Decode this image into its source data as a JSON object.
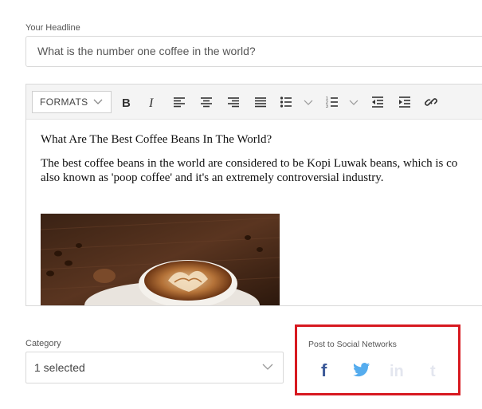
{
  "headline": {
    "label": "Your Headline",
    "value": "What is the number one coffee in the world?"
  },
  "editor": {
    "toolbar": {
      "formats_label": "FORMATS",
      "icons": [
        "bold-icon",
        "italic-icon",
        "align-left-icon",
        "align-center-icon",
        "align-right-icon",
        "align-justify-icon",
        "bullet-list-icon",
        "numbered-list-icon",
        "outdent-icon",
        "indent-icon",
        "link-icon"
      ]
    },
    "content": {
      "heading": "What Are The Best Coffee Beans In The World?",
      "paragraph_line1": "The best coffee beans in the world are considered to be Kopi Luwak beans, which is co",
      "paragraph_line2": "also known as 'poop coffee' and it's an extremely controversial industry."
    }
  },
  "category": {
    "label": "Category",
    "value": "1 selected"
  },
  "social": {
    "label": "Post to Social Networks",
    "networks": [
      {
        "name": "facebook",
        "color": "#3b5998",
        "active": true
      },
      {
        "name": "twitter",
        "color": "#55acee",
        "active": true
      },
      {
        "name": "linkedin",
        "color": "#e3e6ef",
        "active": false
      },
      {
        "name": "tumblr",
        "color": "#e3e6ef",
        "active": false
      }
    ],
    "highlight_color": "#d71920"
  }
}
